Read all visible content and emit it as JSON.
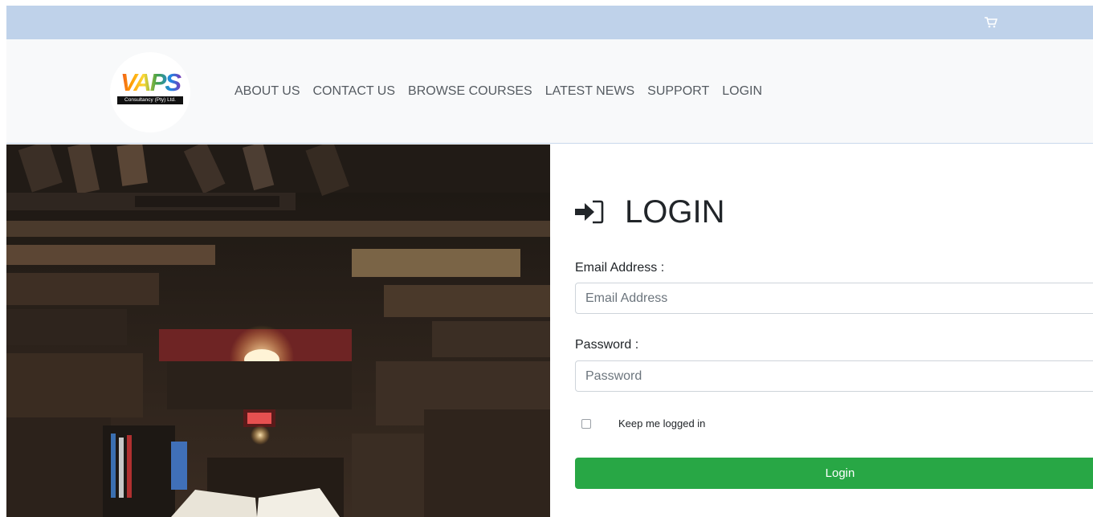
{
  "brand": {
    "logo_word": "VAPS",
    "logo_sub": "Consultancy (Pty) Ltd."
  },
  "nav": {
    "items": [
      "ABOUT US",
      "CONTACT US",
      "BROWSE COURSES",
      "LATEST NEWS",
      "SUPPORT",
      "LOGIN"
    ]
  },
  "topbar": {
    "cart_icon": "shopping-cart-icon"
  },
  "login": {
    "icon": "sign-in-icon",
    "title": "LOGIN",
    "email_label": "Email Address :",
    "email_placeholder": "Email Address",
    "password_label": "Password :",
    "password_placeholder": "Password",
    "remember_label": "Keep me logged in",
    "submit_label": "Login"
  },
  "colors": {
    "topbar": "#bfd2ea",
    "navbar": "#f8f9fa",
    "button": "#28a745"
  }
}
